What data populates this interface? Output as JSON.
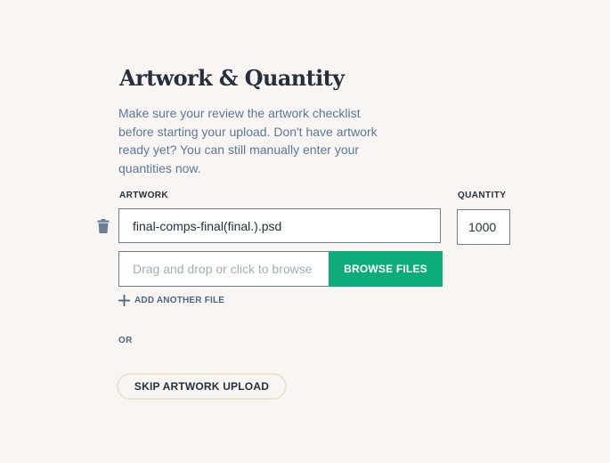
{
  "section": {
    "title": "Artwork & Quantity",
    "description": "Make sure your review the artwork checklist before starting your upload. Don't have artwork ready yet? You can still manually enter your quantities now."
  },
  "labels": {
    "artwork": "ARTWORK",
    "quantity": "QUANTITY"
  },
  "file_row": {
    "filename": "final-comps-final(final.).psd",
    "quantity": "1000",
    "delete_icon": "trash-icon"
  },
  "upload": {
    "placeholder": "Drag and drop or click to browse",
    "browse_label": "BROWSE FILES",
    "add_another_label": "ADD ANOTHER FILE",
    "add_icon": "plus-icon"
  },
  "or_label": "OR",
  "skip_label": "SKIP ARTWORK UPLOAD",
  "colors": {
    "background": "#f8f5f2",
    "accent": "#0cad7a",
    "text_dark": "#25303c",
    "text_muted": "#5a789a",
    "border": "#6d7e92",
    "skip_border": "#efe3cf"
  }
}
